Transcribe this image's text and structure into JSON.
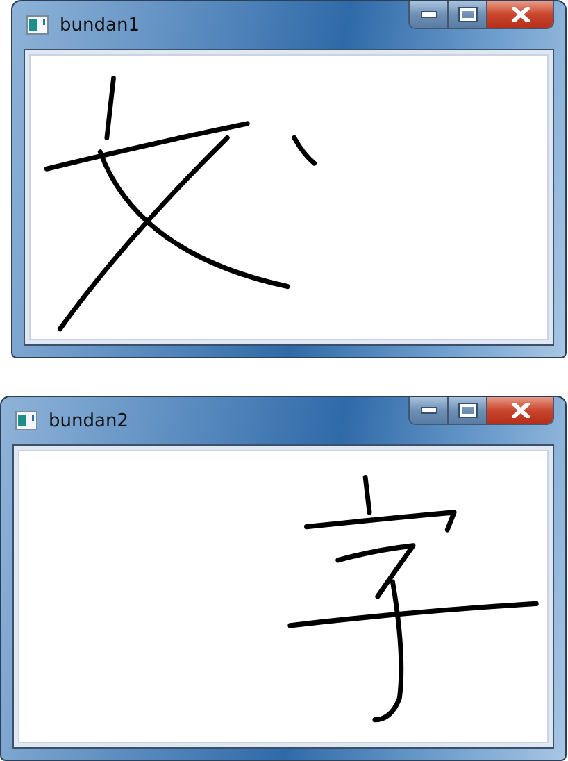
{
  "windows": [
    {
      "title": "bundan1"
    },
    {
      "title": "bundan2"
    }
  ]
}
